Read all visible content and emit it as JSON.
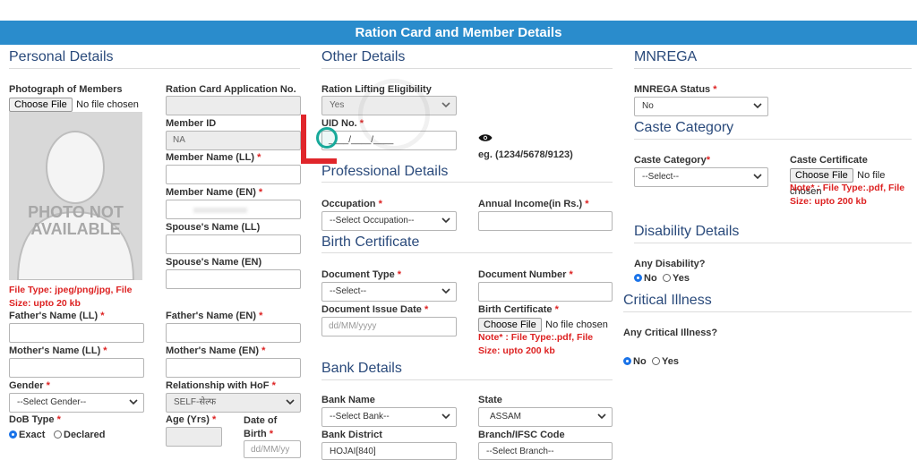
{
  "header": {
    "title": "Ration Card and Member Details"
  },
  "sections": {
    "personal": "Personal Details",
    "other": "Other Details",
    "mnrega": "MNREGA",
    "professional": "Professional Details",
    "birth": "Birth Certificate",
    "bank": "Bank Details",
    "caste": "Caste Category",
    "disability": "Disability Details",
    "critical": "Critical Illness"
  },
  "photo": {
    "label": "Photograph of Members",
    "choose": "Choose File",
    "no_file": "No file chosen",
    "placeholder": "PHOTO NOT AVAILABLE",
    "note": "File Type: jpeg/png/jpg, File Size: upto 20 kb"
  },
  "fields": {
    "rc_app_no": {
      "label": "Ration Card Application No.",
      "value": ""
    },
    "member_id": {
      "label": "Member ID",
      "value": "NA"
    },
    "member_name_ll": {
      "label": "Member Name (LL)",
      "value": ""
    },
    "member_name_en": {
      "label": "Member Name (EN)",
      "value": ""
    },
    "spouse_ll": {
      "label": "Spouse's Name (LL)",
      "value": ""
    },
    "spouse_en": {
      "label": "Spouse's Name (EN)",
      "value": ""
    },
    "father_ll": {
      "label": "Father's Name (LL)",
      "value": ""
    },
    "father_en": {
      "label": "Father's Name (EN)",
      "value": ""
    },
    "mother_ll": {
      "label": "Mother's Name (LL)",
      "value": ""
    },
    "mother_en": {
      "label": "Mother's Name (EN)",
      "value": ""
    },
    "gender": {
      "label": "Gender",
      "value": "--Select Gender--"
    },
    "relationship": {
      "label": "Relationship with HoF",
      "value": "SELF-सेल्फ"
    },
    "dob_type": {
      "label": "DoB Type",
      "exact": "Exact",
      "declared": "Declared"
    },
    "age": {
      "label": "Age (Yrs)",
      "value": ""
    },
    "dob": {
      "label": "Date of Birth",
      "placeholder": "dd/MM/yy"
    },
    "ration_lifting": {
      "label": "Ration Lifting Eligibility",
      "value": "Yes"
    },
    "uid": {
      "label": "UID No.",
      "value": "____/____/____",
      "example": "eg. (1234/5678/9123)"
    },
    "occupation": {
      "label": "Occupation",
      "value": "--Select Occupation--"
    },
    "annual_income": {
      "label": "Annual Income(in Rs.)",
      "value": ""
    },
    "doc_type": {
      "label": "Document Type",
      "value": "--Select--"
    },
    "doc_number": {
      "label": "Document Number",
      "value": ""
    },
    "doc_issue_date": {
      "label": "Document Issue Date",
      "placeholder": "dd/MM/yyyy"
    },
    "birth_cert": {
      "label": "Birth Certificate",
      "choose": "Choose File",
      "no_file": "No file chosen",
      "note": "Note* : File Type:.pdf, File Size: upto 200 kb"
    },
    "bank_name": {
      "label": "Bank Name",
      "value": "--Select Bank--"
    },
    "state": {
      "label": "State",
      "value": "ASSAM"
    },
    "bank_district": {
      "label": "Bank District",
      "value": "HOJAI[840]"
    },
    "branch_ifsc": {
      "label": "Branch/IFSC Code",
      "value": "--Select Branch--"
    },
    "mnrega_status": {
      "label": "MNREGA Status",
      "value": "No"
    },
    "caste_category": {
      "label": "Caste Category",
      "value": "--Select--"
    },
    "caste_cert": {
      "label": "Caste Certificate",
      "choose": "Choose File",
      "no_file": "No file chosen",
      "note": "Note* : File Type:.pdf, File Size: upto 200 kb"
    },
    "any_disability": {
      "label": "Any Disability?",
      "no": "No",
      "yes": "Yes"
    },
    "any_critical": {
      "label": "Any Critical Illness?",
      "no": "No",
      "yes": "Yes"
    }
  },
  "colors": {
    "header": "#2a8ccc",
    "section": "#2a4a7b",
    "required": "#dd2222",
    "annotation": "#e0262b",
    "highlight": "#18a99a"
  }
}
